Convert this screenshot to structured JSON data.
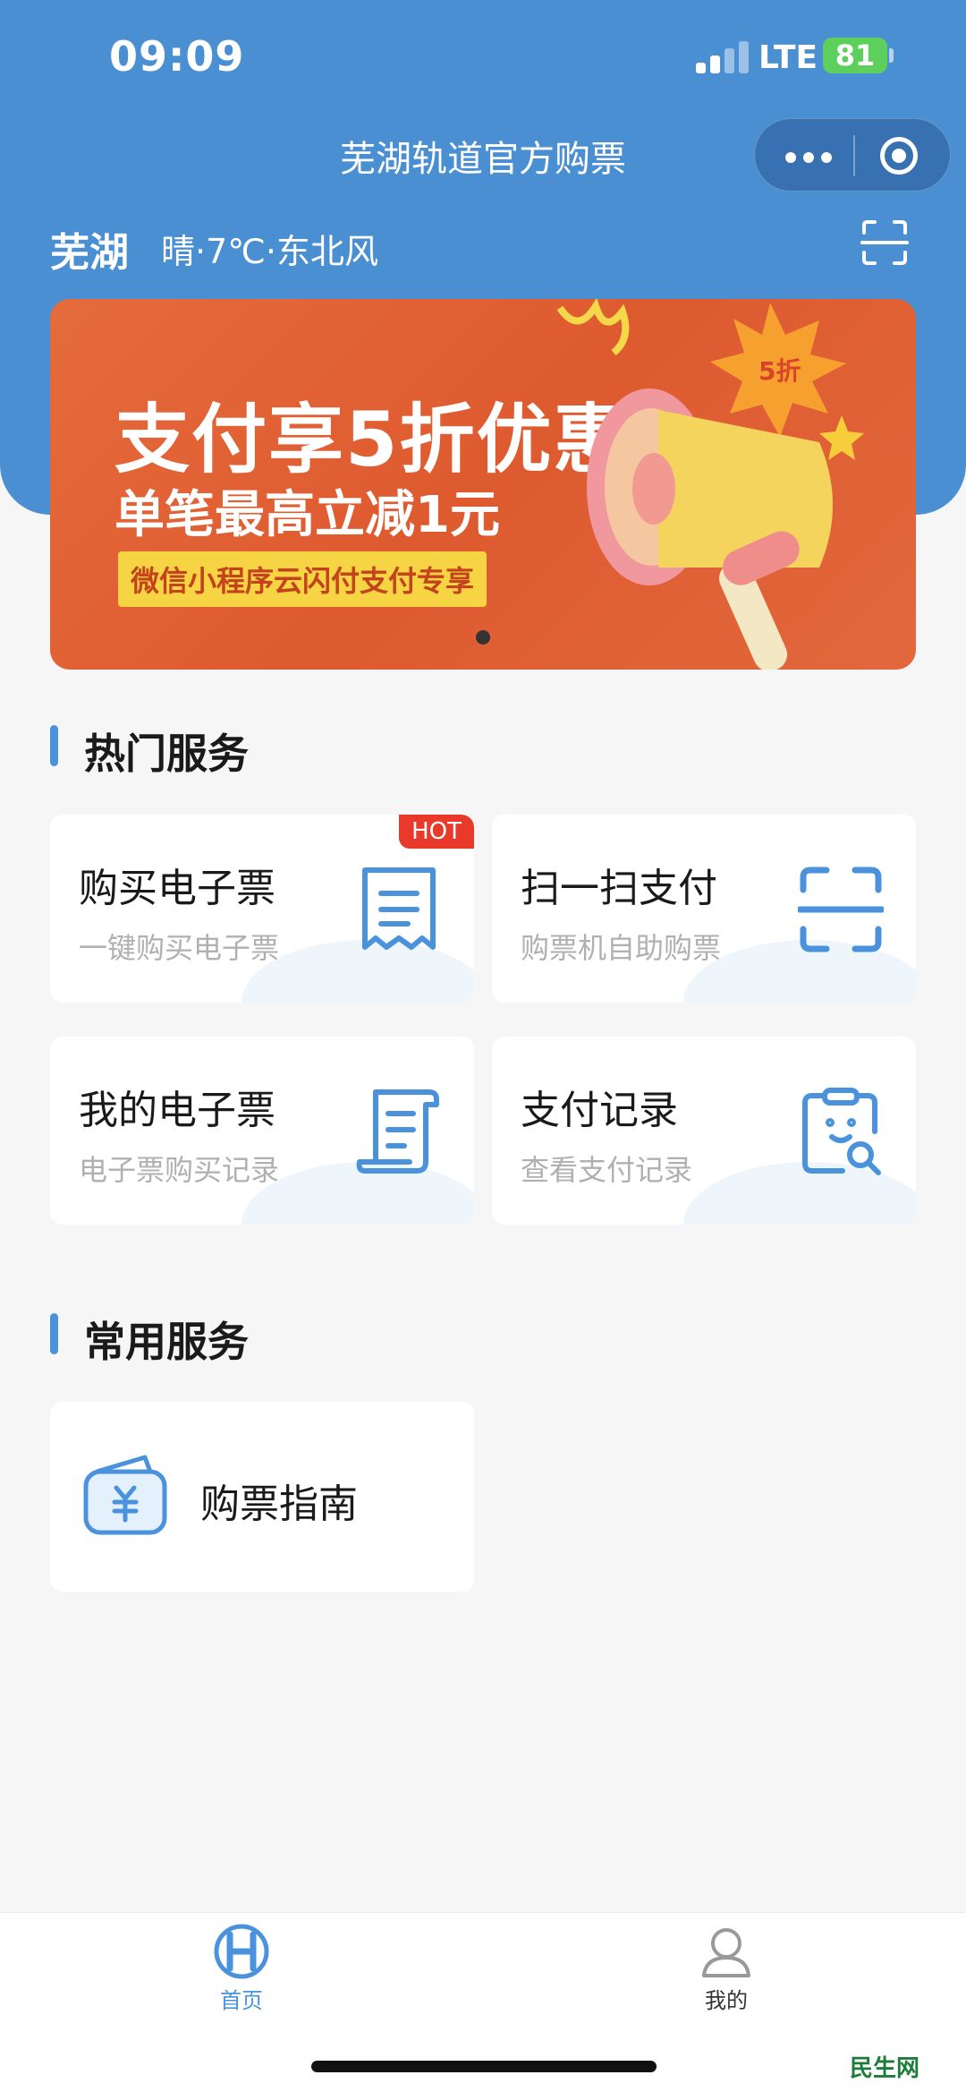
{
  "status_bar": {
    "time": "09:09",
    "network": "LTE",
    "battery": "81"
  },
  "nav": {
    "title": "芜湖轨道官方购票"
  },
  "location": {
    "city": "芜湖",
    "weather": "晴·7℃·东北风"
  },
  "banner": {
    "headline": "支付享5折优惠",
    "subline": "单笔最高立减1元",
    "tag": "微信小程序云闪付支付专享",
    "badge": "5折"
  },
  "hot_services": {
    "title": "热门服务",
    "hot_badge": "HOT",
    "cards": [
      {
        "title": "购买电子票",
        "subtitle": "一键购买电子票",
        "icon": "receipt-icon"
      },
      {
        "title": "扫一扫支付",
        "subtitle": "购票机自助购票",
        "icon": "scan-icon"
      },
      {
        "title": "我的电子票",
        "subtitle": "电子票购买记录",
        "icon": "ticket-scroll-icon"
      },
      {
        "title": "支付记录",
        "subtitle": "查看支付记录",
        "icon": "clipboard-search-icon"
      }
    ]
  },
  "common_services": {
    "title": "常用服务",
    "items": [
      {
        "label": "购票指南",
        "icon": "wallet-yuan-icon"
      }
    ]
  },
  "tabbar": {
    "tabs": [
      {
        "label": "首页",
        "icon": "home-logo-icon",
        "active": true
      },
      {
        "label": "我的",
        "icon": "user-icon",
        "active": false
      }
    ]
  },
  "watermark": "民生网",
  "colors": {
    "primary": "#4a8fd2",
    "accent": "#4a93dc",
    "hot": "#e8392a",
    "banner": "#e56b3c"
  }
}
